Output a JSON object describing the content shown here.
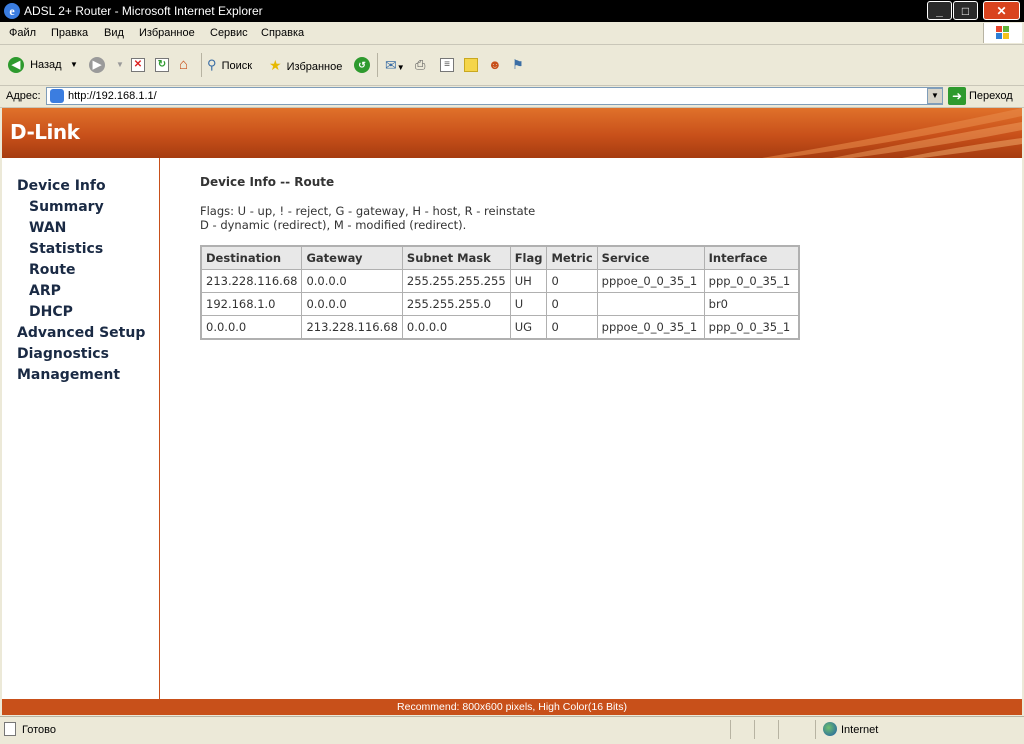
{
  "window": {
    "title": "ADSL 2+ Router - Microsoft Internet Explorer"
  },
  "menu": [
    "Файл",
    "Правка",
    "Вид",
    "Избранное",
    "Сервис",
    "Справка"
  ],
  "toolbar": {
    "back_label": "Назад",
    "search_label": "Поиск",
    "favorites_label": "Избранное"
  },
  "address": {
    "label": "Адрес:",
    "url": "http://192.168.1.1/",
    "go_label": "Переход"
  },
  "brand": {
    "logo": "D-Link"
  },
  "sidebar": {
    "items": [
      {
        "label": "Device Info",
        "level": 0
      },
      {
        "label": "Summary",
        "level": 1
      },
      {
        "label": "WAN",
        "level": 1
      },
      {
        "label": "Statistics",
        "level": 1
      },
      {
        "label": "Route",
        "level": 1
      },
      {
        "label": "ARP",
        "level": 1
      },
      {
        "label": "DHCP",
        "level": 1
      },
      {
        "label": "Advanced Setup",
        "level": 0
      },
      {
        "label": "Diagnostics",
        "level": 0
      },
      {
        "label": "Management",
        "level": 0
      }
    ]
  },
  "page": {
    "heading": "Device Info -- Route",
    "flags_line1": "Flags: U - up, ! - reject, G - gateway, H - host, R - reinstate",
    "flags_line2": "D - dynamic (redirect), M - modified (redirect)."
  },
  "route_table": {
    "headers": [
      "Destination",
      "Gateway",
      "Subnet Mask",
      "Flag",
      "Metric",
      "Service",
      "Interface"
    ],
    "rows": [
      [
        "213.228.116.68",
        "0.0.0.0",
        "255.255.255.255",
        "UH",
        "0",
        "pppoe_0_0_35_1",
        "ppp_0_0_35_1"
      ],
      [
        "192.168.1.0",
        "0.0.0.0",
        "255.255.255.0",
        "U",
        "0",
        "",
        "br0"
      ],
      [
        "0.0.0.0",
        "213.228.116.68",
        "0.0.0.0",
        "UG",
        "0",
        "pppoe_0_0_35_1",
        "ppp_0_0_35_1"
      ]
    ]
  },
  "footer": {
    "text": "Recommend: 800x600 pixels, High Color(16 Bits)"
  },
  "status": {
    "text": "Готово",
    "zone": "Internet"
  },
  "colors": {
    "brand_orange": "#c8501a",
    "nav_text": "#1a2a44"
  }
}
